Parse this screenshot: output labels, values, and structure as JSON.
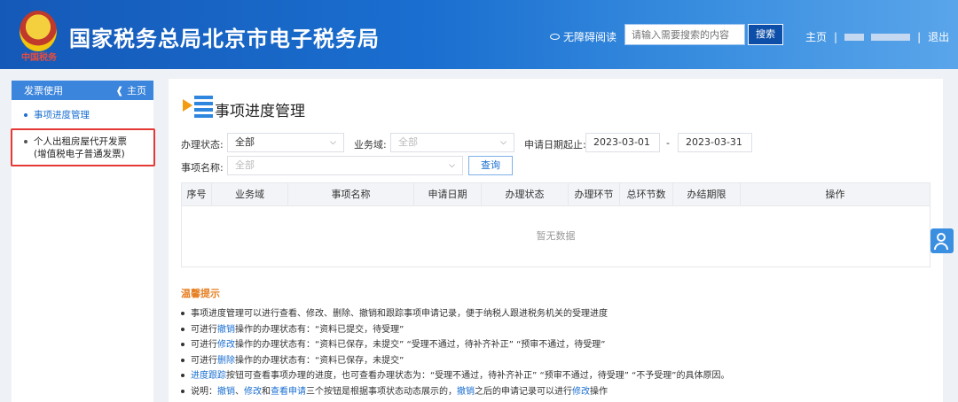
{
  "header": {
    "emblem_text": "中国税务",
    "title": "国家税务总局北京市电子税务局",
    "accessibility": "无障碍阅读",
    "search_placeholder": "请输入需要搜索的内容",
    "search_button": "搜索",
    "home": "主页",
    "separator": "|",
    "logout": "退出"
  },
  "sidebar": {
    "title": "发票使用",
    "home_link": "主页",
    "items": [
      {
        "label": "事项进度管理"
      },
      {
        "label_line1": "个人出租房屋代开发票",
        "label_line2": "(增值税电子普通发票)"
      }
    ]
  },
  "main": {
    "title": "事项进度管理",
    "filters": {
      "status_label": "办理状态:",
      "status_value": "全部",
      "domain_label": "业务域:",
      "domain_value": "全部",
      "date_label": "申请日期起止:",
      "date_start": "2023-03-01",
      "date_dash": "-",
      "date_end": "2023-03-31",
      "name_label": "事项名称:",
      "name_value": "全部",
      "query_button": "查询"
    },
    "table": {
      "columns": [
        "序号",
        "业务域",
        "事项名称",
        "申请日期",
        "办理状态",
        "办理环节",
        "总环节数",
        "办结期限",
        "操作"
      ],
      "empty": "暂无数据"
    },
    "tips": {
      "title": "温馨提示",
      "t1": "事项进度管理可以进行查看、修改、删除、撤销和跟踪事项申请记录，便于纳税人跟进税务机关的受理进度",
      "t2a": "可进行",
      "t2b": "撤销",
      "t2c": "操作的办理状态有：“资料已提交，待受理”",
      "t3a": "可进行",
      "t3b": "修改",
      "t3c": "操作的办理状态有：“资料已保存，未提交” “受理不通过，待补齐补正” “预审不通过，待受理”",
      "t4a": "可进行",
      "t4b": "删除",
      "t4c": "操作的办理状态有：“资料已保存，未提交”",
      "t5a": "进度跟踪",
      "t5b": "按钮可查看事项办理的进度，也可查看办理状态为：“受理不通过，待补齐补正” “预审不通过，待受理” “不予受理”的具体原因。",
      "t6a": "说明：",
      "t6b": "撤销",
      "t6c": "、",
      "t6d": "修改",
      "t6e": "和",
      "t6f": "查看申请",
      "t6g": "三个按钮是根据事项状态动态展示的，",
      "t6h": "撤销",
      "t6i": "之后的申请记录可以进行",
      "t6j": "修改",
      "t6k": "操作"
    }
  },
  "colors": {
    "header_blue": "#1a6fd0",
    "accent": "#1a6fd0",
    "tips_orange": "#e67e22",
    "highlight_red": "#e53935"
  }
}
